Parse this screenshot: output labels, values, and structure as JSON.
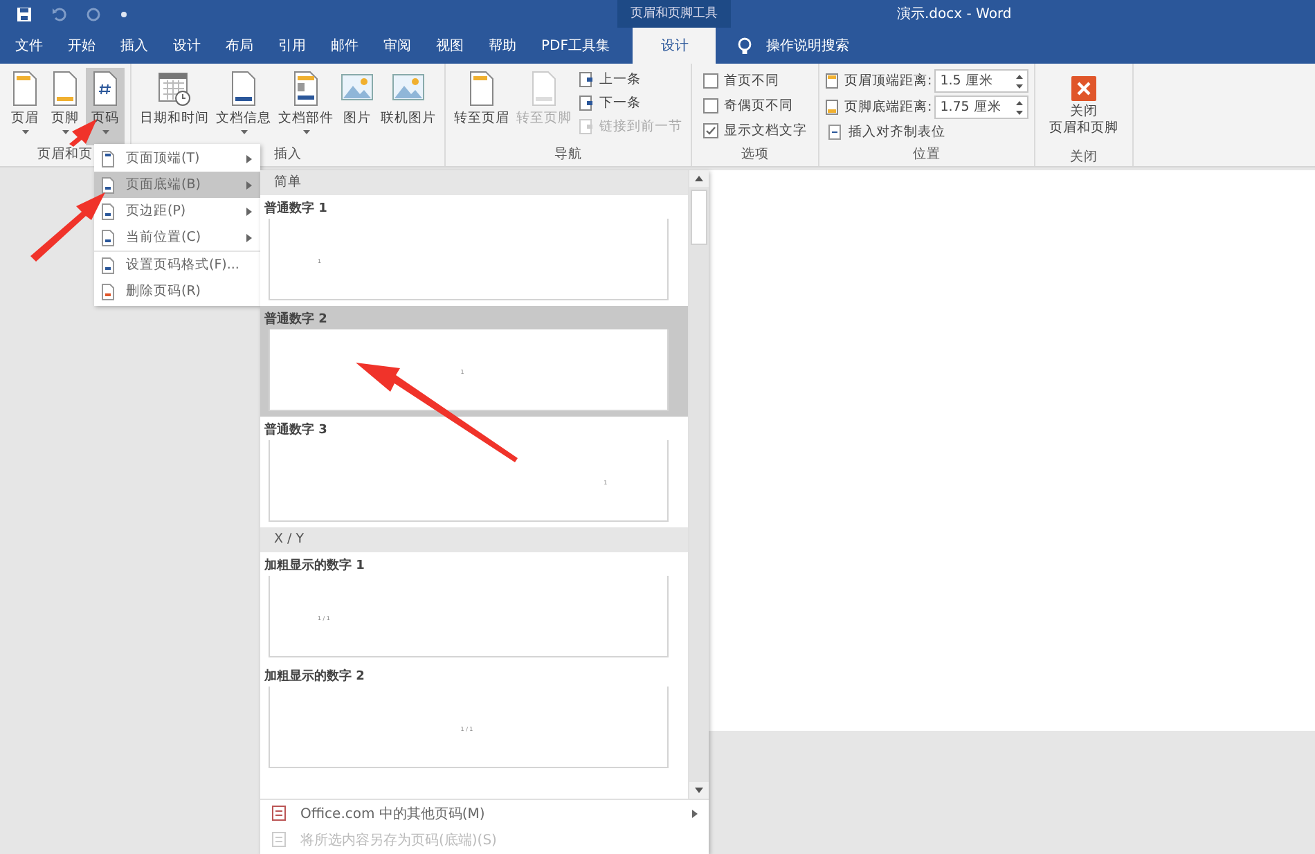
{
  "title_bar": {
    "context_tab": "页眉和页脚工具",
    "title": "演示.docx  -  Word"
  },
  "tabs": [
    {
      "label": "文件",
      "selected": false
    },
    {
      "label": "开始",
      "selected": false
    },
    {
      "label": "插入",
      "selected": false
    },
    {
      "label": "设计",
      "selected": false
    },
    {
      "label": "布局",
      "selected": false
    },
    {
      "label": "引用",
      "selected": false
    },
    {
      "label": "邮件",
      "selected": false
    },
    {
      "label": "审阅",
      "selected": false
    },
    {
      "label": "视图",
      "selected": false
    },
    {
      "label": "帮助",
      "selected": false
    },
    {
      "label": "PDF工具集",
      "selected": false
    },
    {
      "label": "设计",
      "selected": true
    }
  ],
  "tell_me": "操作说明搜索",
  "ribbon_groups": [
    {
      "label": "页眉和页",
      "items": [
        {
          "kind": "large",
          "label": "页眉",
          "dropdown": true,
          "selected": false,
          "disabled": false
        },
        {
          "kind": "large",
          "label": "页脚",
          "dropdown": true,
          "selected": false,
          "disabled": false
        },
        {
          "kind": "large",
          "label": "页码",
          "dropdown": true,
          "selected": true,
          "disabled": false
        }
      ]
    },
    {
      "label": "插入",
      "items": [
        {
          "kind": "large",
          "label": "日期和时间",
          "dropdown": false,
          "selected": false,
          "disabled": false
        },
        {
          "kind": "large",
          "label": "文档信息",
          "dropdown": true,
          "selected": false,
          "disabled": false
        },
        {
          "kind": "large",
          "label": "文档部件",
          "dropdown": true,
          "selected": false,
          "disabled": false
        },
        {
          "kind": "large",
          "label": "图片",
          "dropdown": false,
          "selected": false,
          "disabled": false
        },
        {
          "kind": "large",
          "label": "联机图片",
          "dropdown": false,
          "selected": false,
          "disabled": false
        }
      ]
    },
    {
      "label": "导航",
      "items": [
        {
          "kind": "large",
          "label": "转至页眉",
          "dropdown": false,
          "selected": false,
          "disabled": false
        },
        {
          "kind": "large",
          "label": "转至页脚",
          "dropdown": false,
          "selected": false,
          "disabled": true
        },
        {
          "kind": "stack",
          "entries": [
            {
              "label": "上一条",
              "disabled": false
            },
            {
              "label": "下一条",
              "disabled": false
            },
            {
              "label": "链接到前一节",
              "disabled": true
            }
          ]
        }
      ]
    },
    {
      "label": "选项",
      "items": [
        {
          "kind": "checks",
          "entries": [
            {
              "label": "首页不同",
              "checked": false
            },
            {
              "label": "奇偶页不同",
              "checked": false
            },
            {
              "label": "显示文档文字",
              "checked": true
            }
          ]
        }
      ]
    },
    {
      "label": "位置",
      "items": [
        {
          "kind": "spinners",
          "entries": [
            {
              "label": "页眉顶端距离:",
              "value": "1.5 厘米"
            },
            {
              "label": "页脚底端距离:",
              "value": "1.75 厘米"
            }
          ],
          "link": "插入对齐制表位"
        }
      ]
    },
    {
      "label": "关闭",
      "items": [
        {
          "kind": "close",
          "lines": [
            "关闭",
            "页眉和页脚"
          ]
        }
      ]
    }
  ],
  "menu": [
    {
      "label": "页面顶端(T)",
      "submenu": true,
      "selected": false
    },
    {
      "label": "页面底端(B)",
      "submenu": true,
      "selected": true
    },
    {
      "label": "页边距(P)",
      "submenu": true,
      "selected": false
    },
    {
      "label": "当前位置(C)",
      "submenu": true,
      "selected": false
    },
    {
      "label": "设置页码格式(F)...",
      "submenu": false,
      "selected": false
    },
    {
      "label": "删除页码(R)",
      "submenu": false,
      "selected": false
    }
  ],
  "gallery": {
    "sections": [
      {
        "heading": "简单",
        "items": [
          {
            "label": "普通数字 1",
            "preview": "1",
            "kind": "left",
            "selected": false
          },
          {
            "label": "普通数字 2",
            "preview": "1",
            "kind": "center",
            "selected": true
          },
          {
            "label": "普通数字 3",
            "preview": "1",
            "kind": "right",
            "selected": false
          }
        ]
      },
      {
        "heading": "X / Y",
        "items": [
          {
            "label": "加粗显示的数字 1",
            "preview": "1 / 1",
            "kind": "left",
            "selected": false
          },
          {
            "label": "加粗显示的数字 2",
            "preview": "1 / 1",
            "kind": "center",
            "selected": false
          }
        ]
      }
    ],
    "footer": [
      {
        "label": "Office.com 中的其他页码(M)",
        "submenu": true,
        "disabled": false
      },
      {
        "label": "将所选内容另存为页码(底端)(S)",
        "submenu": false,
        "disabled": true
      }
    ]
  }
}
